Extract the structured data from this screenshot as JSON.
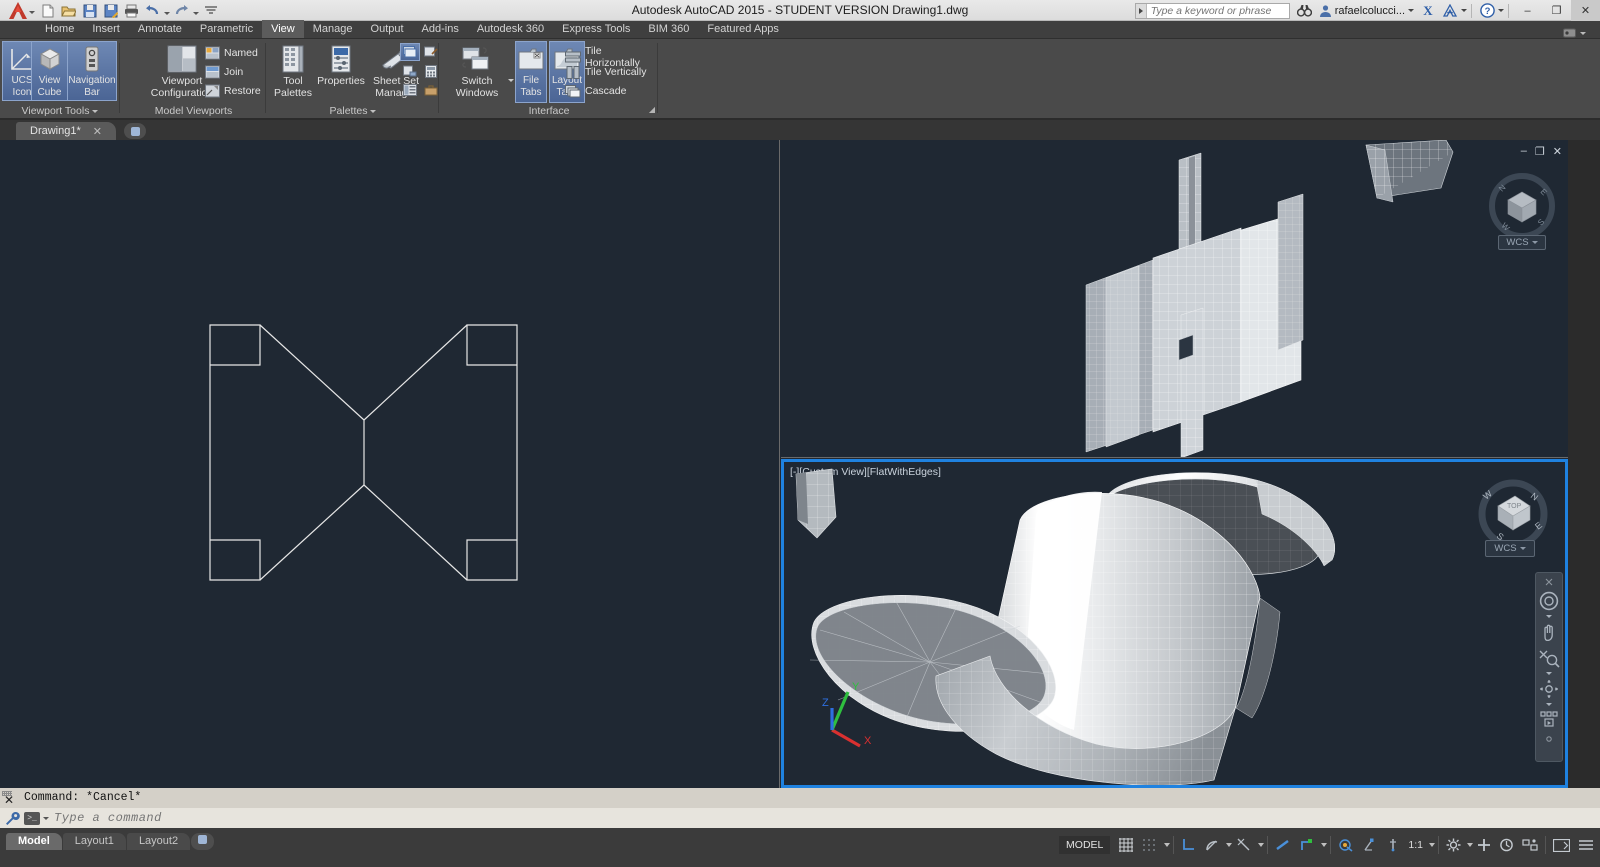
{
  "window": {
    "title": "Autodesk AutoCAD 2015 - STUDENT VERSION     Drawing1.dwg",
    "minimize": "–",
    "maximize": "❐",
    "close": "✕"
  },
  "quick_access": {
    "new_label": "New",
    "open_label": "Open",
    "save_label": "Save",
    "saveas_label": "Save As",
    "plot_label": "Plot",
    "undo_label": "Undo",
    "redo_label": "Redo",
    "more_label": "More"
  },
  "search": {
    "placeholder": "Type a keyword or phrase",
    "binoculars": "search-binoculars",
    "user": "rafaelcolucci...",
    "exchange": "X",
    "autodesk_a": "A",
    "help": "?"
  },
  "ribbon": {
    "tabs": [
      {
        "label": "Home",
        "active": false
      },
      {
        "label": "Insert",
        "active": false
      },
      {
        "label": "Annotate",
        "active": false
      },
      {
        "label": "Parametric",
        "active": false
      },
      {
        "label": "View",
        "active": true
      },
      {
        "label": "Manage",
        "active": false
      },
      {
        "label": "Output",
        "active": false
      },
      {
        "label": "Add-ins",
        "active": false
      },
      {
        "label": "Autodesk 360",
        "active": false
      },
      {
        "label": "Express Tools",
        "active": false
      },
      {
        "label": "BIM 360",
        "active": false
      },
      {
        "label": "Featured Apps",
        "active": false
      }
    ],
    "groups": {
      "viewport_tools": {
        "title": "Viewport Tools",
        "ucs_icon": "UCS\nIcon",
        "ucs_icon_l1": "UCS",
        "ucs_icon_l2": "Icon",
        "view_cube_l1": "View",
        "view_cube_l2": "Cube",
        "nav_bar_l1": "Navigation",
        "nav_bar_l2": "Bar"
      },
      "model_viewports": {
        "title": "Model Viewports",
        "viewport_config_l1": "Viewport",
        "viewport_config_l2": "Configuration",
        "named": "Named",
        "join": "Join",
        "restore": "Restore"
      },
      "palettes": {
        "title": "Palettes",
        "tool_palettes_l1": "Tool",
        "tool_palettes_l2": "Palettes",
        "properties": "Properties",
        "sheet_set_l1": "Sheet Set",
        "sheet_set_l2": "Manager"
      },
      "interface": {
        "title": "Interface",
        "switch_windows_l1": "Switch",
        "switch_windows_l2": "Windows",
        "file_tabs_l1": "File",
        "file_tabs_l2": "Tabs",
        "layout_tabs_l1": "Layout",
        "layout_tabs_l2": "Tabs",
        "tile_horizontally": "Tile Horizontally",
        "tile_vertically": "Tile Vertically",
        "cascade": "Cascade"
      }
    }
  },
  "file_tabs": {
    "items": [
      {
        "label": "Drawing1*",
        "close": "✕",
        "active": true
      }
    ],
    "add_label": "+"
  },
  "viewports": {
    "left": {
      "name": "top-left-wireframe-viewport",
      "active": false
    },
    "right_top": {
      "name": "right-top-3d-viewport",
      "active": false,
      "minimize": "–",
      "maximize": "❐",
      "close": "✕",
      "wcs_label": "WCS"
    },
    "right_bottom": {
      "name": "right-bottom-3d-viewport",
      "active": true,
      "label": "[-][Custom View][FlatWithEdges]",
      "wcs_label": "WCS",
      "ucs_x": "X",
      "ucs_y": "Y",
      "ucs_z": "Z"
    }
  },
  "command_line": {
    "history": "Command: *Cancel*",
    "placeholder": "Type a command",
    "close": "✕"
  },
  "status_bar": {
    "layout_tabs": [
      {
        "label": "Model",
        "active": true
      },
      {
        "label": "Layout1",
        "active": false
      },
      {
        "label": "Layout2",
        "active": false
      }
    ],
    "add_layout": "+",
    "model_space": "MODEL",
    "annotation_scale": "1:1",
    "icons": [
      "grid-display-icon",
      "snap-mode-icon",
      "ortho-mode-icon",
      "polar-tracking-icon",
      "object-snap-tracking-icon",
      "object-snap-icon",
      "lineweight-icon",
      "transparency-icon",
      "selection-cycling-icon",
      "3d-object-snap-icon",
      "dynamic-ucs-icon",
      "annotation-visibility-icon",
      "workspace-switching-icon",
      "hardware-acceleration-icon",
      "isolate-objects-icon",
      "clean-screen-icon",
      "customization-icon"
    ]
  },
  "colors": {
    "accent_blue": "#1f82e0",
    "canvas_bg": "#1f2833",
    "ribbon_bg": "#4a4a4a",
    "titlebar_bg": "#e4e4e4",
    "selected_btn": "#4b6595"
  }
}
